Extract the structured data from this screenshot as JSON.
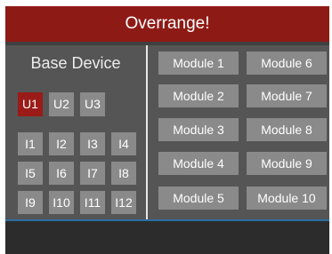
{
  "header": {
    "title": "Overrange!"
  },
  "base_device": {
    "title": "Base Device",
    "units": [
      "U1",
      "U2",
      "U3"
    ],
    "selected_unit": "U1",
    "inputs": [
      "I1",
      "I2",
      "I3",
      "I4",
      "I5",
      "I6",
      "I7",
      "I8",
      "I9",
      "I10",
      "I11",
      "I12"
    ]
  },
  "modules": [
    "Module 1",
    "Module 2",
    "Module 3",
    "Module 4",
    "Module 5",
    "Module 6",
    "Module 7",
    "Module 8",
    "Module 9",
    "Module 10"
  ],
  "colors": {
    "header_bg": "#8e1a16",
    "selected_unit_bg": "#9a1b17",
    "button_bg": "#8a8a8a",
    "panel_bg": "#555555",
    "footer_accent": "#2a6ea3"
  }
}
